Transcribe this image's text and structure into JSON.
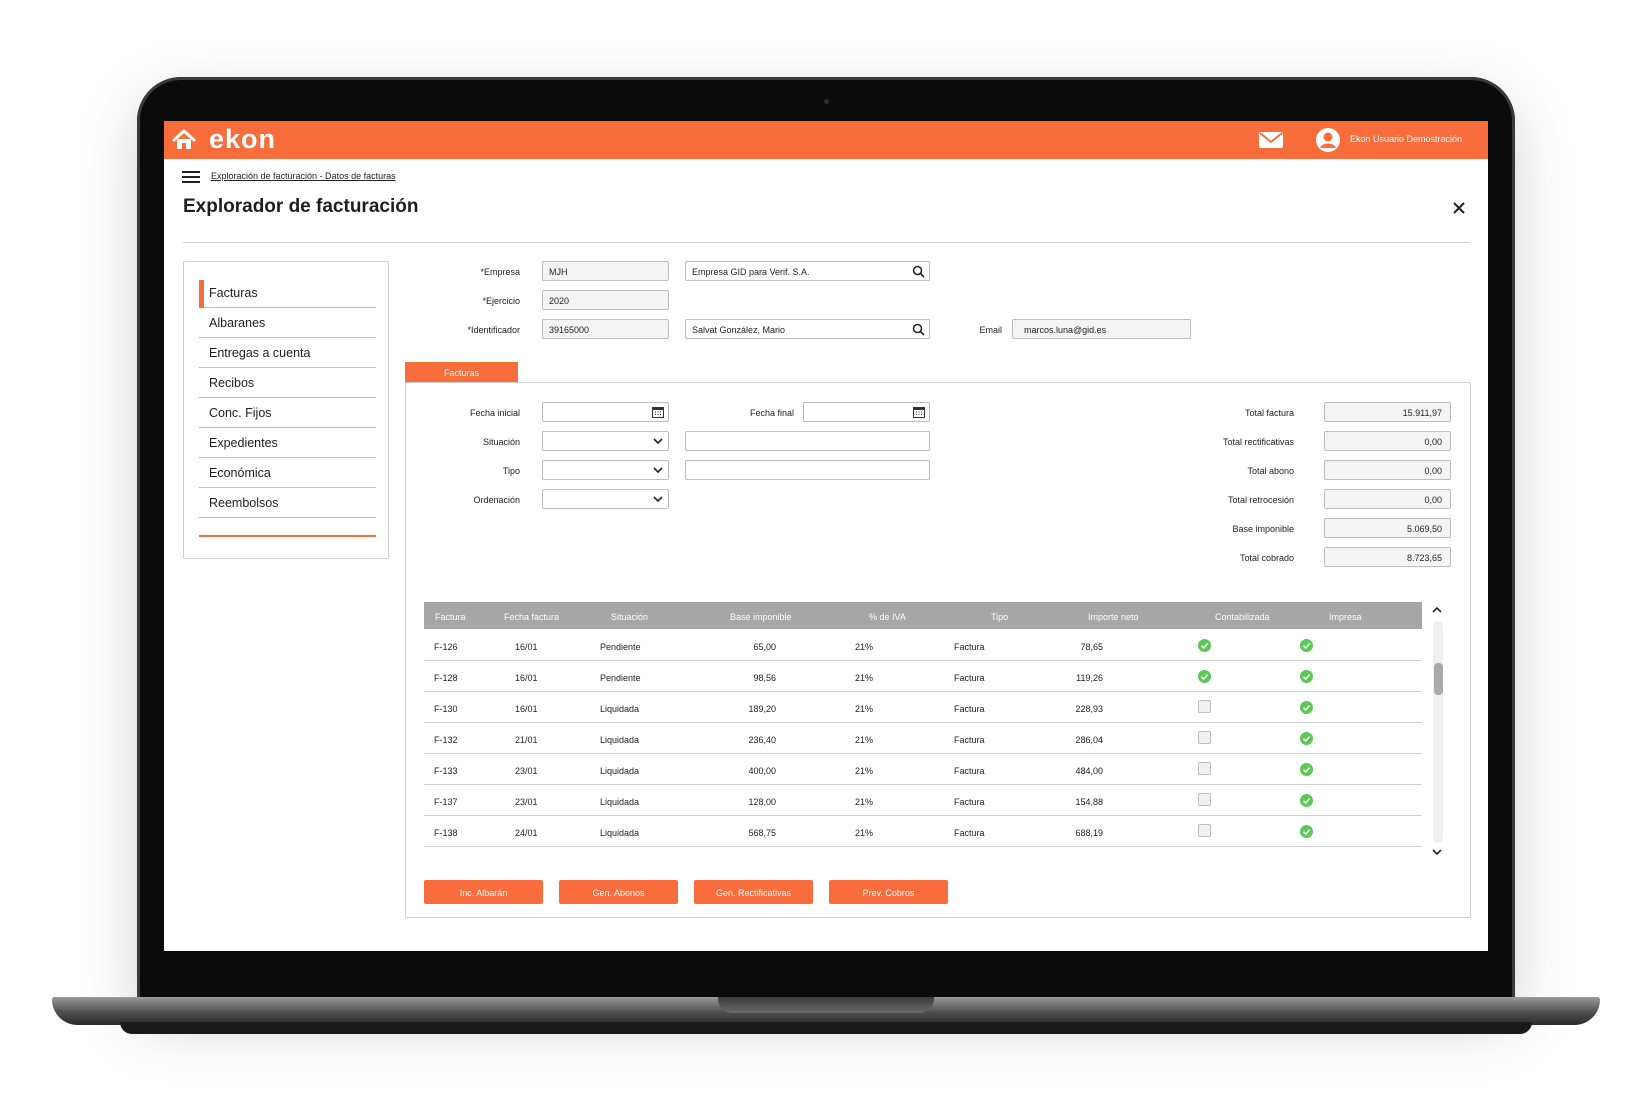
{
  "app": {
    "logo": "ekon",
    "user_name": "Ekon Usuario Demostración"
  },
  "breadcrumb": "Exploración de facturación - Datos de facturas",
  "page_title": "Explorador de facturación",
  "sidebar": {
    "items": [
      {
        "label": "Facturas",
        "active": true
      },
      {
        "label": "Albaranes"
      },
      {
        "label": "Entregas a cuenta"
      },
      {
        "label": "Recibos"
      },
      {
        "label": "Conc. Fijos"
      },
      {
        "label": "Expedientes"
      },
      {
        "label": "Económica"
      },
      {
        "label": "Reembolsos"
      }
    ]
  },
  "form": {
    "empresa": {
      "label": "*Empresa",
      "code": "MJH",
      "name": "Empresa GID para Verif. S.A."
    },
    "ejercicio": {
      "label": "*Ejercicio",
      "value": "2020"
    },
    "identificador": {
      "label": "*Identificador",
      "value": "39165000",
      "name": "Salvat González, Mario"
    },
    "email": {
      "label": "Email",
      "value": "marcos.luna@gid.es"
    }
  },
  "tab_label": "Facturas",
  "filters": {
    "fecha_inicial": "Fecha inicial",
    "fecha_final": "Fecha final",
    "situacion": "Situación",
    "tipo": "Tipo",
    "ordenacion": "Ordenación"
  },
  "totals": [
    {
      "label": "Total factura",
      "value": "15.911,97"
    },
    {
      "label": "Total rectificativas",
      "value": "0,00"
    },
    {
      "label": "Total abono",
      "value": "0,00"
    },
    {
      "label": "Total retrocesión",
      "value": "0,00"
    },
    {
      "label": "Base imponible",
      "value": "5.069,50"
    },
    {
      "label": "Total cobrado",
      "value": "8.723,65"
    }
  ],
  "table": {
    "headers": [
      "Factura",
      "Fecha factura",
      "Situación",
      "Base imponible",
      "% de IVA",
      "Tipo",
      "Importe neto",
      "Contabilizada",
      "Impresa"
    ],
    "rows": [
      {
        "factura": "F-126",
        "fecha": "16/01",
        "situacion": "Pendiente",
        "base": "65,00",
        "iva": "21%",
        "tipo": "Factura",
        "neto": "78,65",
        "contabilizada": true,
        "impresa": true
      },
      {
        "factura": "F-128",
        "fecha": "16/01",
        "situacion": "Pendiente",
        "base": "98,56",
        "iva": "21%",
        "tipo": "Factura",
        "neto": "119,26",
        "contabilizada": true,
        "impresa": true
      },
      {
        "factura": "F-130",
        "fecha": "16/01",
        "situacion": "Liquidada",
        "base": "189,20",
        "iva": "21%",
        "tipo": "Factura",
        "neto": "228,93",
        "contabilizada": false,
        "impresa": true
      },
      {
        "factura": "F-132",
        "fecha": "21/01",
        "situacion": "Liquidada",
        "base": "236,40",
        "iva": "21%",
        "tipo": "Factura",
        "neto": "286,04",
        "contabilizada": false,
        "impresa": true
      },
      {
        "factura": "F-133",
        "fecha": "23/01",
        "situacion": "Liquidada",
        "base": "400,00",
        "iva": "21%",
        "tipo": "Factura",
        "neto": "484,00",
        "contabilizada": false,
        "impresa": true
      },
      {
        "factura": "F-137",
        "fecha": "23/01",
        "situacion": "Liquidada",
        "base": "128,00",
        "iva": "21%",
        "tipo": "Factura",
        "neto": "154,88",
        "contabilizada": false,
        "impresa": true
      },
      {
        "factura": "F-138",
        "fecha": "24/01",
        "situacion": "Liquidada",
        "base": "568,75",
        "iva": "21%",
        "tipo": "Factura",
        "neto": "688,19",
        "contabilizada": false,
        "impresa": true
      }
    ]
  },
  "buttons": [
    "Inc. Albarán",
    "Gen. Abonos",
    "Gen. Rectificativas",
    "Prev. Cobros"
  ],
  "colors": {
    "brand": "#f96c3c",
    "check": "#5cc85a",
    "header_gray": "#a6a6a6"
  }
}
